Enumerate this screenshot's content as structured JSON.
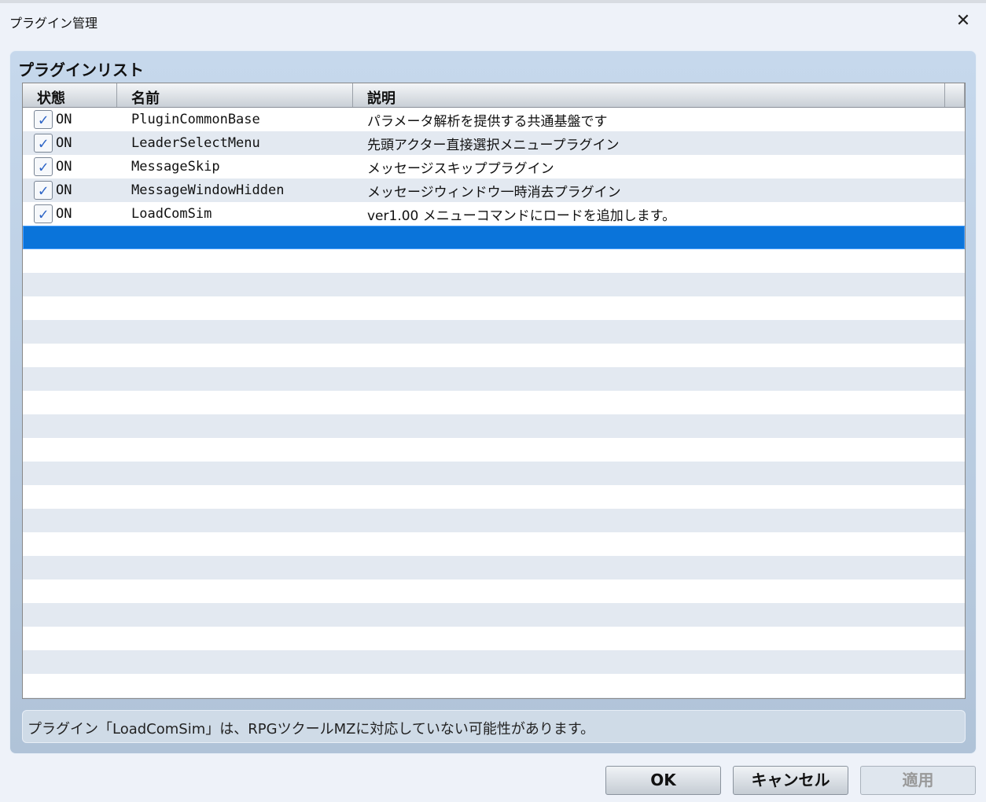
{
  "window": {
    "title": "プラグイン管理",
    "close_icon": "close-icon"
  },
  "panel": {
    "title": "プラグインリスト"
  },
  "table": {
    "headers": [
      "状態",
      "名前",
      "説明"
    ],
    "rows": [
      {
        "status": "ON",
        "name": "PluginCommonBase",
        "description": "パラメータ解析を提供する共通基盤です"
      },
      {
        "status": "ON",
        "name": "LeaderSelectMenu",
        "description": "先頭アクター直接選択メニュープラグイン"
      },
      {
        "status": "ON",
        "name": "MessageSkip",
        "description": "メッセージスキッププラグイン"
      },
      {
        "status": "ON",
        "name": "MessageWindowHidden",
        "description": "メッセージウィンドウ一時消去プラグイン"
      },
      {
        "status": "ON",
        "name": "LoadComSim",
        "description": "ver1.00 メニューコマンドにロードを追加します。"
      }
    ]
  },
  "status_message": "プラグイン「LoadComSim」は、RPGツクールMZに対応していない可能性があります。",
  "buttons": {
    "ok": "OK",
    "cancel": "キャンセル",
    "apply": "適用"
  }
}
